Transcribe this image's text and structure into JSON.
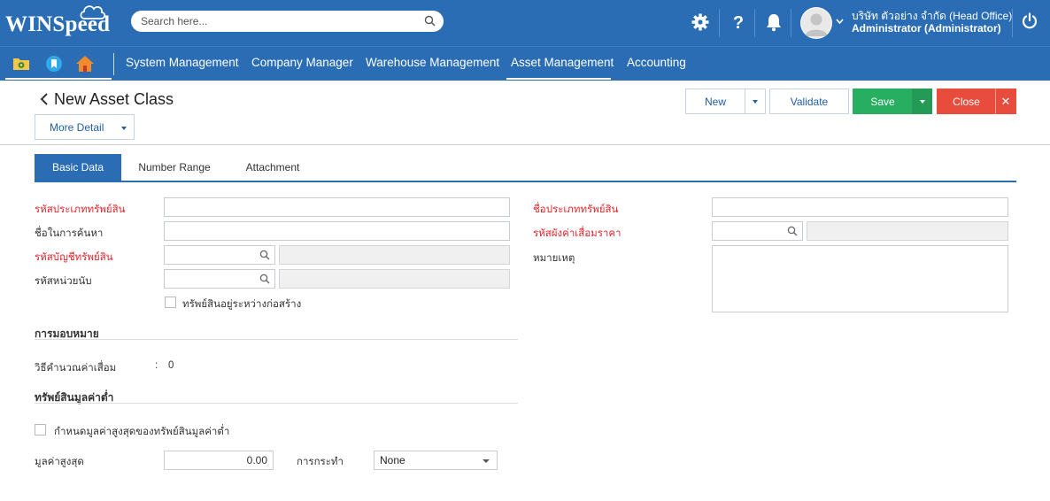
{
  "header": {
    "logo": "WINSpeed",
    "search_placeholder": "Search here...",
    "company": "บริษัท ตัวอย่าง จำกัด (Head Office)",
    "user": "Administrator (Administrator)"
  },
  "menu": {
    "items": [
      {
        "label": "System Management"
      },
      {
        "label": "Company Manager"
      },
      {
        "label": "Warehouse Management"
      },
      {
        "label": "Asset Management",
        "active": true
      },
      {
        "label": "Accounting"
      }
    ]
  },
  "page": {
    "title": "New Asset Class",
    "more_detail": "More Detail",
    "buttons": {
      "new": "New",
      "validate": "Validate",
      "save": "Save",
      "close": "Close",
      "close_x": "✕"
    }
  },
  "tabs": [
    {
      "label": "Basic Data",
      "active": true
    },
    {
      "label": "Number Range"
    },
    {
      "label": "Attachment"
    }
  ],
  "form": {
    "asset_class_code": {
      "label": "รหัสประเภททรัพย์สิน",
      "required": true,
      "value": ""
    },
    "asset_class_name": {
      "label": "ชื่อประเภททรัพย์สิน",
      "required": true,
      "value": ""
    },
    "search_name": {
      "label": "ชื่อในการค้นหา",
      "value": ""
    },
    "depreciation_chart": {
      "label": "รหัสผังค่าเสื่อมราคา",
      "required": true,
      "value": ""
    },
    "asset_account": {
      "label": "รหัสบัญชีทรัพย์สิน",
      "required": true,
      "value": ""
    },
    "remark": {
      "label": "หมายเหตุ",
      "value": ""
    },
    "unit_code": {
      "label": "รหัสหน่วยนับ",
      "value": ""
    },
    "under_construction": {
      "label": "ทรัพย์สินอยู่ระหว่างก่อสร้าง",
      "checked": false
    },
    "assignment_section": "การมอบหมาย",
    "depreciation_method": {
      "label": "วิธีคำนวณค่าเสื่อม",
      "separator": ":",
      "value": "0"
    },
    "low_value_section": "ทรัพย์สินมูลค่าต่ำ",
    "set_max_low_value": {
      "label": "กำหนดมูลค่าสูงสุดของทรัพย์สินมูลค่าต่ำ",
      "checked": false
    },
    "max_value": {
      "label": "มูลค่าสูงสุด",
      "value": "0.00"
    },
    "action": {
      "label": "การกระทำ",
      "value": "None"
    }
  },
  "colors": {
    "brand_blue": "#2a6db5",
    "save_green": "#27ae60",
    "close_red": "#e74c3c",
    "required_red": "#e0262b"
  },
  "icons": [
    "cloud-icon",
    "search-icon",
    "gear-icon",
    "help-icon",
    "bell-icon",
    "avatar",
    "chevron-down-icon",
    "power-icon",
    "folder-icon",
    "bookmark-icon",
    "home-icon",
    "back-arrow-icon",
    "lookup-icon",
    "caret-down-icon",
    "close-icon"
  ]
}
